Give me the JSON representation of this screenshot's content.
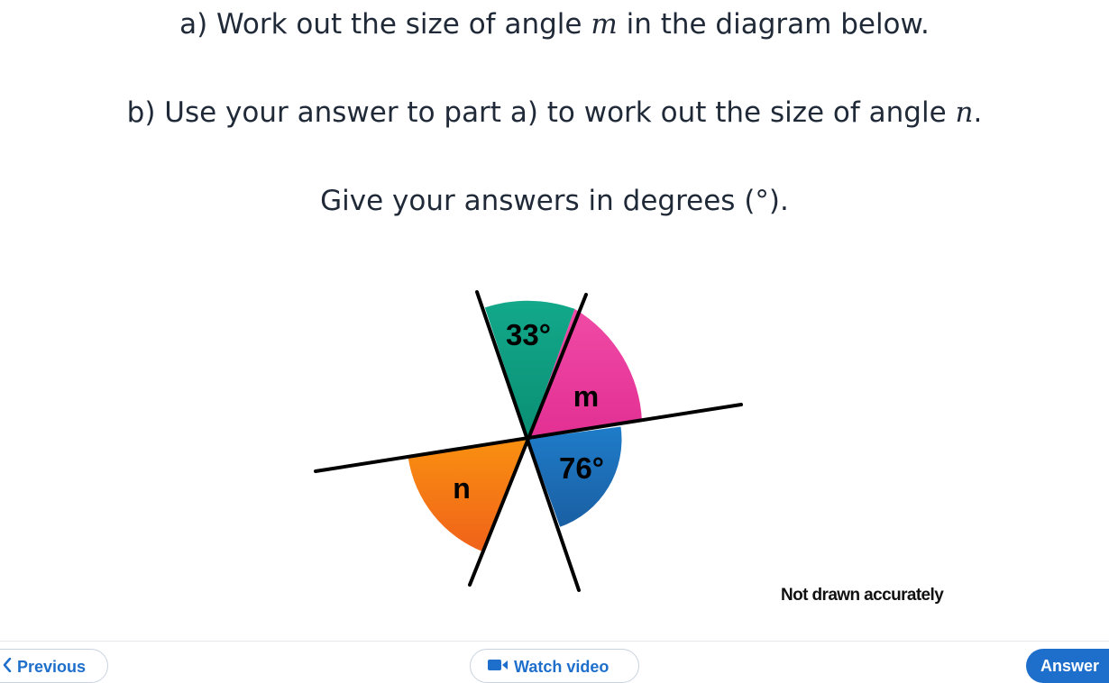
{
  "question": {
    "part_a": {
      "prefix": "a) Work out the size of angle ",
      "var": "m",
      "suffix": " in the diagram below."
    },
    "part_b": {
      "prefix": "b) Use your answer to part a) to work out the size of angle ",
      "var": "n",
      "suffix": "."
    },
    "instruction": {
      "prefix": "Give your answers in degrees ",
      "symbol": "(°)",
      "suffix": "."
    }
  },
  "diagram": {
    "angle_top": "33°",
    "angle_m": "m",
    "angle_bottom_right": "76°",
    "angle_n": "n",
    "note": "Not drawn accurately",
    "colors": {
      "teal": "#0e9c7e",
      "pink": "#ee3b9e",
      "blue": "#1d6fb8",
      "orange": "#f57a14"
    }
  },
  "footer": {
    "previous_label": "Previous",
    "video_label": "Watch video",
    "answer_label": "Answer"
  }
}
